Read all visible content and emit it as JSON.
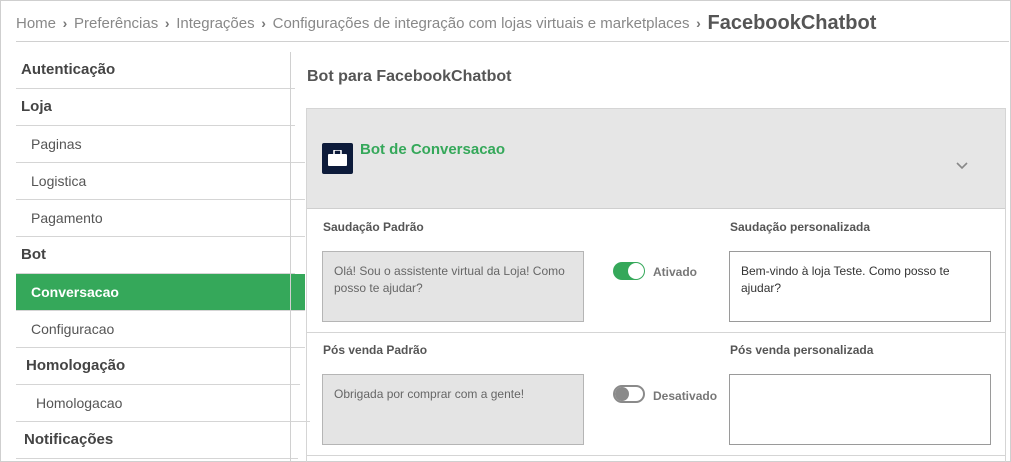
{
  "breadcrumb": {
    "items": [
      "Home",
      "Preferências",
      "Integrações",
      "Configurações de integração com lojas virtuais e marketplaces"
    ],
    "current": "FacebookChatbot"
  },
  "sidebar": {
    "items": [
      {
        "label": "Autenticação"
      },
      {
        "label": "Loja"
      },
      {
        "label": "Paginas"
      },
      {
        "label": "Logistica"
      },
      {
        "label": "Pagamento"
      },
      {
        "label": "Bot"
      },
      {
        "label": "Conversacao"
      },
      {
        "label": "Configuracao"
      },
      {
        "label": "Homologação"
      },
      {
        "label": "Homologacao"
      },
      {
        "label": "Notificações"
      }
    ],
    "active": "Conversacao"
  },
  "main": {
    "title": "Bot para FacebookChatbot",
    "panel": {
      "title": "Bot de Conversacao",
      "icon": "briefcase-icon",
      "greeting": {
        "default_label": "Saudação Padrão",
        "default_text": "Olá! Sou o assistente virtual da Loja! Como posso te ajudar?",
        "toggle_label": "Ativado",
        "toggle_on": true,
        "custom_label": "Saudação personalizada",
        "custom_text": "Bem-vindo à loja Teste. Como posso te ajudar?"
      },
      "post_sale": {
        "default_label": "Pós venda Padrão",
        "default_text": "Obrigada por comprar com a gente!",
        "toggle_label": "Desativado",
        "toggle_on": false,
        "custom_label": "Pós venda personalizada",
        "custom_text": ""
      }
    }
  },
  "colors": {
    "accent": "#35a85a",
    "icon_bg": "#0d1b3a"
  }
}
